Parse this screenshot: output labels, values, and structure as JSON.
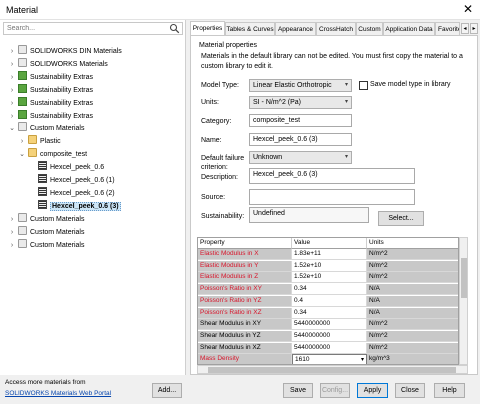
{
  "window": {
    "title": "Material",
    "close_glyph": "✕"
  },
  "search": {
    "placeholder": "Search..."
  },
  "tree": [
    {
      "label": "SOLIDWORKS DIN Materials",
      "icon": "database-icon",
      "chev": "›",
      "indent": 0
    },
    {
      "label": "SOLIDWORKS Materials",
      "icon": "database-icon",
      "chev": "›",
      "indent": 0
    },
    {
      "label": "Sustainability Extras",
      "icon": "green-library-icon",
      "chev": "›",
      "indent": 0
    },
    {
      "label": "Sustainability Extras",
      "icon": "green-library-icon",
      "chev": "›",
      "indent": 0
    },
    {
      "label": "Sustainability Extras",
      "icon": "green-library-icon",
      "chev": "›",
      "indent": 0
    },
    {
      "label": "Sustainability Extras",
      "icon": "green-library-icon",
      "chev": "›",
      "indent": 0
    },
    {
      "label": "Custom Materials",
      "icon": "database-icon",
      "chev": "⌄",
      "indent": 0
    },
    {
      "label": "Plastic",
      "icon": "folder-icon",
      "chev": "›",
      "indent": 1
    },
    {
      "label": "composite_test",
      "icon": "folder-icon",
      "chev": "⌄",
      "indent": 1
    },
    {
      "label": "Hexcel_peek_0.6",
      "icon": "material-icon",
      "chev": "",
      "indent": 2
    },
    {
      "label": "Hexcel_peek_0.6 (1)",
      "icon": "material-icon",
      "chev": "",
      "indent": 2
    },
    {
      "label": "Hexcel_peek_0.6 (2)",
      "icon": "material-icon",
      "chev": "",
      "indent": 2
    },
    {
      "label": "Hexcel_peek_0.6 (3)",
      "icon": "material-icon",
      "chev": "",
      "indent": 2,
      "selected": true
    },
    {
      "label": "Custom Materials",
      "icon": "database-icon",
      "chev": "›",
      "indent": 0
    },
    {
      "label": "Custom Materials",
      "icon": "database-icon",
      "chev": "›",
      "indent": 0
    },
    {
      "label": "Custom Materials",
      "icon": "database-icon",
      "chev": "›",
      "indent": 0
    }
  ],
  "footer_left": {
    "access_text": "Access more materials from",
    "portal_link": "SOLIDWORKS Materials Web Portal",
    "add_button": "Add..."
  },
  "tabs": [
    "Properties",
    "Tables & Curves",
    "Appearance",
    "CrossHatch",
    "Custom",
    "Application Data",
    "Favorite"
  ],
  "tab_scroll": {
    "left": "◂",
    "right": "▸"
  },
  "properties": {
    "heading": "Material properties",
    "note": "Materials in the default library can not be edited. You must first copy the material to a custom library to edit it.",
    "model_type_label": "Model Type:",
    "model_type_value": "Linear Elastic Orthotropic",
    "save_model_type_label": "Save model type in library",
    "units_label": "Units:",
    "units_value": "SI - N/m^2 (Pa)",
    "category_label": "Category:",
    "category_value": "composite_test",
    "name_label": "Name:",
    "name_value": "Hexcel_peek_0.6 (3)",
    "failure_label": "Default failure criterion:",
    "failure_value": "Unknown",
    "description_label": "Description:",
    "description_value": "Hexcel_peek_0.6 (3)",
    "source_label": "Source:",
    "source_value": "",
    "sustainability_label": "Sustainability:",
    "sustainability_value": "Undefined",
    "select_button": "Select..."
  },
  "grid": {
    "headers": [
      "Property",
      "Value",
      "Units"
    ],
    "rows": [
      {
        "property": "Elastic Modulus in X",
        "value": "1.83e+11",
        "units": "N/m^2",
        "red": true
      },
      {
        "property": "Elastic Modulus in Y",
        "value": "1.52e+10",
        "units": "N/m^2",
        "red": true
      },
      {
        "property": "Elastic Modulus in Z",
        "value": "1.52e+10",
        "units": "N/m^2",
        "red": true
      },
      {
        "property": "Poisson's Ratio in XY",
        "value": "0.34",
        "units": "N/A",
        "red": true
      },
      {
        "property": "Poisson's Ratio in YZ",
        "value": "0.4",
        "units": "N/A",
        "red": true
      },
      {
        "property": "Poisson's Ratio in XZ",
        "value": "0.34",
        "units": "N/A",
        "red": true
      },
      {
        "property": "Shear Modulus in XY",
        "value": "5440000000",
        "units": "N/m^2",
        "red": false
      },
      {
        "property": "Shear Modulus in YZ",
        "value": "5440000000",
        "units": "N/m^2",
        "red": false
      },
      {
        "property": "Shear Modulus in XZ",
        "value": "5440000000",
        "units": "N/m^2",
        "red": false
      },
      {
        "property": "Mass Density",
        "value": "1610",
        "units": "kg/m^3",
        "red": true,
        "editing": true
      }
    ]
  },
  "buttons": {
    "save": "Save",
    "config": "Config...",
    "apply": "Apply",
    "close": "Close",
    "help": "Help"
  },
  "colors": {
    "required_property": "#d8142a",
    "selection": "#cde6f7",
    "link": "#0645ad",
    "default_button_border": "#0078d7"
  }
}
